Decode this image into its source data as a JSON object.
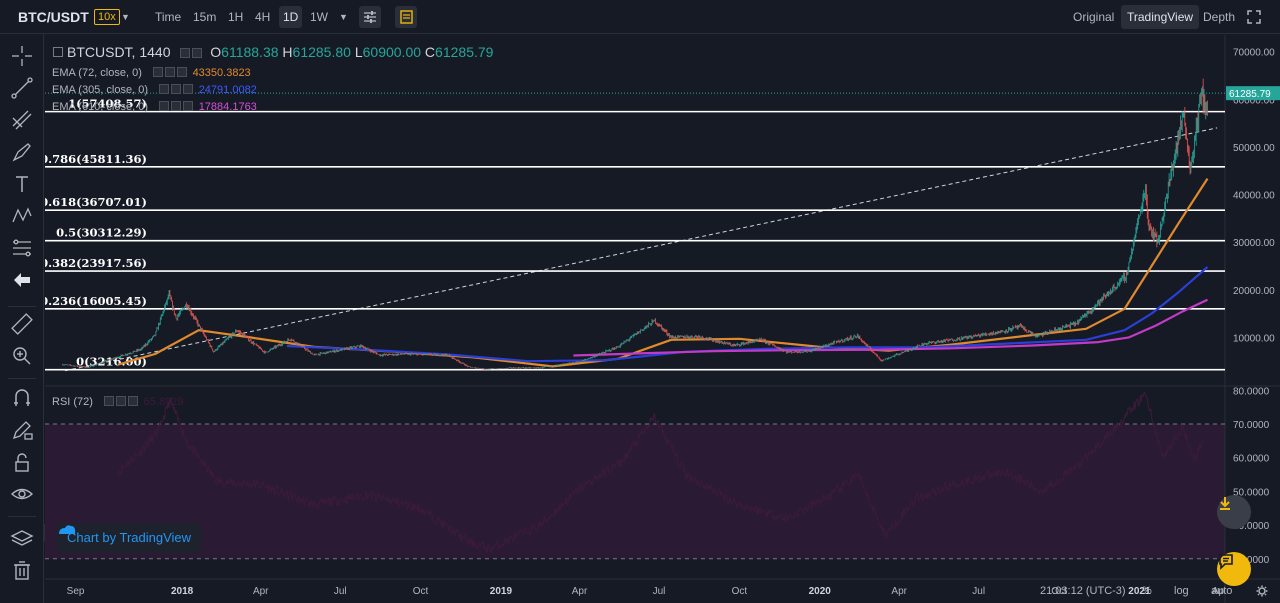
{
  "toolbar": {
    "symbol": "BTC/USDT",
    "leverage": "10x",
    "intervals": [
      "Time",
      "15m",
      "1H",
      "4H",
      "1D",
      "1W"
    ],
    "active_interval": "1D",
    "views": [
      "Original",
      "TradingView",
      "Depth"
    ],
    "active_view": "TradingView"
  },
  "legend": {
    "symbol_interval": "BTCUSDT, 1440",
    "open_label": "O",
    "open": "61188.38",
    "high_label": "H",
    "high": "61285.80",
    "low_label": "L",
    "low": "60900.00",
    "close_label": "C",
    "close": "61285.79",
    "ema1_label": "EMA (72, close, 0)",
    "ema1_value": "43350.3823",
    "ema2_label": "EMA (305, close, 0)",
    "ema2_value": "24791.0082",
    "ema3_label": "EMA (610, close, 0)",
    "ema3_value": "17884.1763",
    "rsi_label": "RSI (72)",
    "rsi_value": "65.8929"
  },
  "colors": {
    "background": "#161a25",
    "up": "#26a69a",
    "down": "#ef5350",
    "ema72": "#e08a2e",
    "ema305": "#2a3fd6",
    "ema610": "#c23bc6",
    "fib": "#ffffff",
    "rsi_fill": "#2a1a33",
    "rsi_line": "#3b1b3a",
    "price_tag": "#26a69a",
    "accent": "#f0b90b"
  },
  "watermark": "Chart by TradingView",
  "bottom": {
    "time": "21:03:12 (UTC-3)",
    "percent": "%",
    "log": "log",
    "auto": "auto"
  },
  "chart_data": [
    {
      "type": "candlestick",
      "title": "BTCUSDT, 1440",
      "xlabel": "",
      "ylabel": "",
      "x_ticks": [
        "Sep",
        "2018",
        "Apr",
        "Jul",
        "Oct",
        "2019",
        "Apr",
        "Jul",
        "Oct",
        "2020",
        "Apr",
        "Jul",
        "Oct",
        "2021",
        "Ap"
      ],
      "y_ticks": [
        "70000.00",
        "60000.00",
        "50000.00",
        "40000.00",
        "30000.00",
        "20000.00",
        "10000.00"
      ],
      "ylim": [
        0,
        73500
      ],
      "last_price": "61285.79",
      "price_path": {
        "x": [
          "2017-08-17",
          "2017-09-15",
          "2017-10-15",
          "2017-11-15",
          "2017-12-01",
          "2017-12-17",
          "2017-12-25",
          "2018-01-06",
          "2018-02-06",
          "2018-03-05",
          "2018-04-06",
          "2018-05-05",
          "2018-06-01",
          "2018-07-25",
          "2018-08-15",
          "2018-09-15",
          "2018-11-01",
          "2018-11-25",
          "2018-12-15",
          "2019-01-15",
          "2019-02-15",
          "2019-04-02",
          "2019-05-15",
          "2019-06-26",
          "2019-07-15",
          "2019-08-15",
          "2019-09-25",
          "2019-10-26",
          "2019-11-25",
          "2019-12-20",
          "2020-01-15",
          "2020-02-13",
          "2020-03-12",
          "2020-04-30",
          "2020-06-01",
          "2020-07-27",
          "2020-08-17",
          "2020-09-05",
          "2020-10-21",
          "2020-11-25",
          "2020-12-17",
          "2021-01-08",
          "2021-01-11",
          "2021-01-22",
          "2021-02-08",
          "2021-02-21",
          "2021-02-28",
          "2021-03-13",
          "2021-03-20"
        ],
        "y": [
          4300,
          3700,
          5600,
          7500,
          10500,
          19000,
          14000,
          17000,
          7000,
          11500,
          6800,
          9700,
          6300,
          8200,
          6300,
          6500,
          6300,
          3800,
          3300,
          3600,
          3600,
          4900,
          8000,
          13500,
          10000,
          10200,
          8300,
          9500,
          6900,
          7100,
          8700,
          10300,
          5100,
          8700,
          9500,
          11200,
          12300,
          10200,
          13000,
          19000,
          23000,
          41500,
          34000,
          30000,
          46000,
          57500,
          45000,
          61200,
          58000
        ]
      },
      "fib_levels": [
        {
          "label": "1(57408.57)",
          "ratio": 1,
          "value": 57408.57
        },
        {
          "label": "0.786(45811.36)",
          "ratio": 0.786,
          "value": 45811.36
        },
        {
          "label": "0.618(36707.01)",
          "ratio": 0.618,
          "value": 36707.01
        },
        {
          "label": "0.5(30312.29)",
          "ratio": 0.5,
          "value": 30312.29
        },
        {
          "label": "0.382(23917.56)",
          "ratio": 0.382,
          "value": 23917.56
        },
        {
          "label": "0.236(16005.45)",
          "ratio": 0.236,
          "value": 16005.45
        },
        {
          "label": "0(3216.00)",
          "ratio": 0,
          "value": 3216.0
        }
      ],
      "trendline": {
        "x": [
          "2017-08-20",
          "2021-03-31"
        ],
        "y": [
          3000,
          54000
        ]
      },
      "series": [
        {
          "name": "EMA (72, close, 0)",
          "x": [
            "2017-10-20",
            "2017-12-01",
            "2018-01-20",
            "2018-03-20",
            "2018-06-01",
            "2018-09-01",
            "2018-12-01",
            "2019-03-01",
            "2019-05-15",
            "2019-07-15",
            "2019-10-01",
            "2020-01-01",
            "2020-03-20",
            "2020-06-01",
            "2020-09-01",
            "2020-11-01",
            "2020-12-15",
            "2021-01-15",
            "2021-02-15",
            "2021-03-20"
          ],
          "y": [
            4300,
            6500,
            11500,
            10000,
            8000,
            7000,
            5800,
            3900,
            5500,
            9500,
            9700,
            8000,
            7200,
            8500,
            10500,
            11800,
            16000,
            25000,
            34000,
            43350
          ]
        },
        {
          "name": "EMA (305, close, 0)",
          "x": [
            "2018-05-01",
            "2018-08-01",
            "2018-11-01",
            "2019-02-01",
            "2019-05-01",
            "2019-08-01",
            "2019-11-01",
            "2020-02-01",
            "2020-05-01",
            "2020-08-01",
            "2020-11-01",
            "2020-12-15",
            "2021-01-15",
            "2021-02-15",
            "2021-03-20"
          ],
          "y": [
            8200,
            7400,
            6400,
            5000,
            5200,
            7000,
            7600,
            7900,
            7900,
            8700,
            9500,
            11500,
            15000,
            19500,
            24791
          ]
        },
        {
          "name": "EMA (610, close, 0)",
          "x": [
            "2019-03-25",
            "2019-06-01",
            "2019-09-01",
            "2019-12-01",
            "2020-03-01",
            "2020-06-01",
            "2020-09-01",
            "2020-11-15",
            "2020-12-20",
            "2021-01-20",
            "2021-02-20",
            "2021-03-20"
          ],
          "y": [
            6200,
            6600,
            7100,
            7300,
            7400,
            7700,
            8300,
            9000,
            10000,
            12500,
            15500,
            17884
          ]
        }
      ]
    },
    {
      "type": "line",
      "title": "RSI (72)",
      "y_ticks": [
        "80.0000",
        "70.0000",
        "60.0000",
        "50.0000",
        "40.0000",
        "30.0000"
      ],
      "ylim": [
        24,
        81
      ],
      "bands": [
        70,
        30
      ],
      "series": [
        {
          "name": "RSI (72)",
          "x": [
            "2017-10-20",
            "2017-11-15",
            "2017-12-05",
            "2017-12-18",
            "2018-01-08",
            "2018-02-10",
            "2018-04-01",
            "2018-06-01",
            "2018-08-01",
            "2018-10-01",
            "2018-11-25",
            "2018-12-20",
            "2019-02-15",
            "2019-04-02",
            "2019-05-20",
            "2019-06-26",
            "2019-08-01",
            "2019-10-01",
            "2019-11-25",
            "2020-01-15",
            "2020-02-13",
            "2020-03-16",
            "2020-04-20",
            "2020-06-01",
            "2020-08-01",
            "2020-09-10",
            "2020-10-25",
            "2020-12-01",
            "2021-01-08",
            "2021-01-28",
            "2021-02-20",
            "2021-03-05",
            "2021-03-15"
          ],
          "y": [
            56,
            62,
            68,
            77,
            64,
            53,
            52,
            46,
            49,
            45,
            35,
            33,
            40,
            51,
            59,
            72,
            55,
            46,
            42,
            49,
            55,
            37,
            48,
            52,
            56,
            50,
            58,
            68,
            79,
            60,
            69,
            59,
            66
          ]
        }
      ]
    }
  ]
}
